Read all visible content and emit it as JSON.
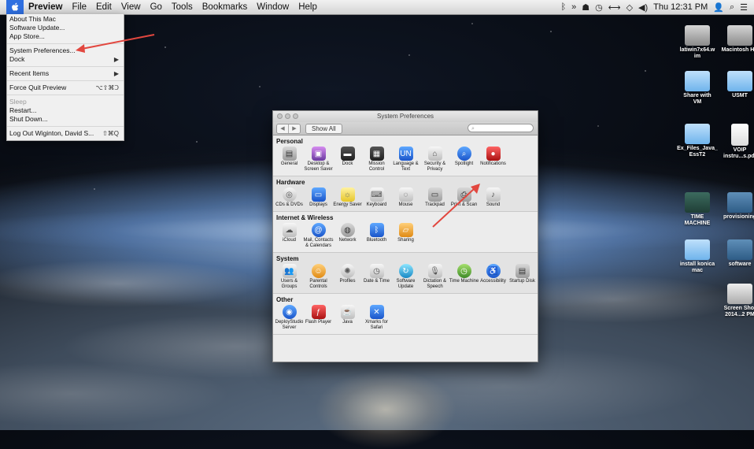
{
  "menubar": {
    "app_name": "Preview",
    "menus": [
      "File",
      "Edit",
      "View",
      "Go",
      "Tools",
      "Bookmarks",
      "Window",
      "Help"
    ],
    "clock": "Thu 12:31 PM"
  },
  "apple_menu": {
    "items": [
      {
        "label": "About This Mac",
        "shortcut": "",
        "disabled": false
      },
      {
        "label": "Software Update...",
        "shortcut": "",
        "disabled": false
      },
      {
        "label": "App Store...",
        "shortcut": "",
        "disabled": false
      },
      {
        "sep": true
      },
      {
        "label": "System Preferences...",
        "shortcut": "",
        "disabled": false
      },
      {
        "label": "Dock",
        "shortcut": "▶",
        "disabled": false
      },
      {
        "sep": true
      },
      {
        "label": "Recent Items",
        "shortcut": "▶",
        "disabled": false
      },
      {
        "sep": true
      },
      {
        "label": "Force Quit Preview",
        "shortcut": "⌥⇧⌘Ↄ",
        "disabled": false
      },
      {
        "sep": true
      },
      {
        "label": "Sleep",
        "shortcut": "",
        "disabled": true
      },
      {
        "label": "Restart...",
        "shortcut": "",
        "disabled": false
      },
      {
        "label": "Shut Down...",
        "shortcut": "",
        "disabled": false
      },
      {
        "sep": true
      },
      {
        "label": "Log Out Wiginton, David S...",
        "shortcut": "⇧⌘Q",
        "disabled": false
      }
    ]
  },
  "prefs": {
    "title": "System Preferences",
    "show_all": "Show All",
    "sections": [
      {
        "title": "Personal",
        "panes": [
          {
            "label": "General",
            "icon": "general-icon",
            "color": "gray",
            "glyph": "▤"
          },
          {
            "label": "Desktop & Screen Saver",
            "icon": "desktop-icon",
            "color": "purple",
            "glyph": "▣"
          },
          {
            "label": "Dock",
            "icon": "dock-icon",
            "color": "dark",
            "glyph": "▬"
          },
          {
            "label": "Mission Control",
            "icon": "mission-control-icon",
            "color": "dark",
            "glyph": "▦"
          },
          {
            "label": "Language & Text",
            "icon": "language-icon",
            "color": "blue",
            "glyph": "UN"
          },
          {
            "label": "Security & Privacy",
            "icon": "security-icon",
            "color": "silver",
            "glyph": "⌂"
          },
          {
            "label": "Spotlight",
            "icon": "spotlight-icon",
            "color": "blue",
            "glyph": "⌕",
            "round": true
          },
          {
            "label": "Notifications",
            "icon": "notifications-icon",
            "color": "red",
            "glyph": "●"
          }
        ]
      },
      {
        "title": "Hardware",
        "panes": [
          {
            "label": "CDs & DVDs",
            "icon": "cd-icon",
            "color": "silver",
            "glyph": "◎",
            "round": true
          },
          {
            "label": "Displays",
            "icon": "displays-icon",
            "color": "blue",
            "glyph": "▭"
          },
          {
            "label": "Energy Saver",
            "icon": "energy-icon",
            "color": "yellow",
            "glyph": "☼"
          },
          {
            "label": "Keyboard",
            "icon": "keyboard-icon",
            "color": "silver",
            "glyph": "⌨"
          },
          {
            "label": "Mouse",
            "icon": "mouse-icon",
            "color": "silver",
            "glyph": "◌"
          },
          {
            "label": "Trackpad",
            "icon": "trackpad-icon",
            "color": "gray",
            "glyph": "▭"
          },
          {
            "label": "Print & Scan",
            "icon": "printer-icon",
            "color": "gray",
            "glyph": "⎙"
          },
          {
            "label": "Sound",
            "icon": "sound-icon",
            "color": "silver",
            "glyph": "♪"
          }
        ]
      },
      {
        "title": "Internet & Wireless",
        "panes": [
          {
            "label": "iCloud",
            "icon": "icloud-icon",
            "color": "silver",
            "glyph": "☁"
          },
          {
            "label": "Mail, Contacts & Calendars",
            "icon": "mail-icon",
            "color": "blue",
            "glyph": "@",
            "round": true
          },
          {
            "label": "Network",
            "icon": "network-icon",
            "color": "gray",
            "glyph": "◍",
            "round": true
          },
          {
            "label": "Bluetooth",
            "icon": "bluetooth-icon",
            "color": "blue",
            "glyph": "ᛒ"
          },
          {
            "label": "Sharing",
            "icon": "sharing-icon",
            "color": "orange",
            "glyph": "▱"
          }
        ]
      },
      {
        "title": "System",
        "panes": [
          {
            "label": "Users & Groups",
            "icon": "users-icon",
            "color": "silver",
            "glyph": "👥"
          },
          {
            "label": "Parental Controls",
            "icon": "parental-controls-icon",
            "color": "orange",
            "glyph": "☺",
            "round": true
          },
          {
            "label": "Profiles",
            "icon": "profiles-icon",
            "color": "silver",
            "glyph": "✺",
            "round": true
          },
          {
            "label": "Date & Time",
            "icon": "date-time-icon",
            "color": "silver",
            "glyph": "◷"
          },
          {
            "label": "Software Update",
            "icon": "software-update-icon",
            "color": "teal",
            "glyph": "↻",
            "round": true
          },
          {
            "label": "Dictation & Speech",
            "icon": "dictation-icon",
            "color": "silver",
            "glyph": "🎙"
          },
          {
            "label": "Time Machine",
            "icon": "time-machine-icon",
            "color": "green",
            "glyph": "◷",
            "round": true
          },
          {
            "label": "Accessibility",
            "icon": "accessibility-icon",
            "color": "blue",
            "glyph": "♿",
            "round": true
          },
          {
            "label": "Startup Disk",
            "icon": "startup-disk-icon",
            "color": "gray",
            "glyph": "▤"
          }
        ]
      },
      {
        "title": "Other",
        "panes": [
          {
            "label": "DeployStudio Server",
            "icon": "deploystudio-icon",
            "color": "blue",
            "glyph": "◉",
            "round": true
          },
          {
            "label": "Flash Player",
            "icon": "flash-icon",
            "color": "red",
            "glyph": "ƒ"
          },
          {
            "label": "Java",
            "icon": "java-icon",
            "color": "silver",
            "glyph": "☕"
          },
          {
            "label": "Xmarks for Safari",
            "icon": "xmarks-icon",
            "color": "blue",
            "glyph": "✕"
          }
        ]
      }
    ]
  },
  "desktop_icons": [
    {
      "label": "latiwin7x64.vmwarevm",
      "display": "latiwin7x64.w\nim",
      "kind": "drive"
    },
    {
      "label": "Macintosh HD",
      "display": "Macintosh HD",
      "kind": "drive"
    },
    {
      "label": "Share with VM",
      "display": "Share with\nVM",
      "kind": "folder"
    },
    {
      "label": "USMT",
      "display": "USMT",
      "kind": "folder"
    },
    {
      "label": "Ex_Files_Java_EssT2",
      "display": "Ex_Files_Java_\nEssT2",
      "kind": "folder"
    },
    {
      "label": "VOIP instru...s.pdf",
      "display": "VOIP\ninstru...s.pdf",
      "kind": "doc"
    },
    {
      "label": "TIME MACHINE",
      "display": "TIME\nMACHINE",
      "kind": "tm"
    },
    {
      "label": "provisioning",
      "display": "provisioning",
      "kind": "netvol"
    },
    {
      "label": "install konica mac",
      "display": "install konica\nmac",
      "kind": "folder"
    },
    {
      "label": "software",
      "display": "software",
      "kind": "netvol"
    },
    {
      "label": "Screen Shot 2014...2 PM",
      "display": "Screen Shot\n2014...2 PM",
      "kind": "shot"
    }
  ]
}
